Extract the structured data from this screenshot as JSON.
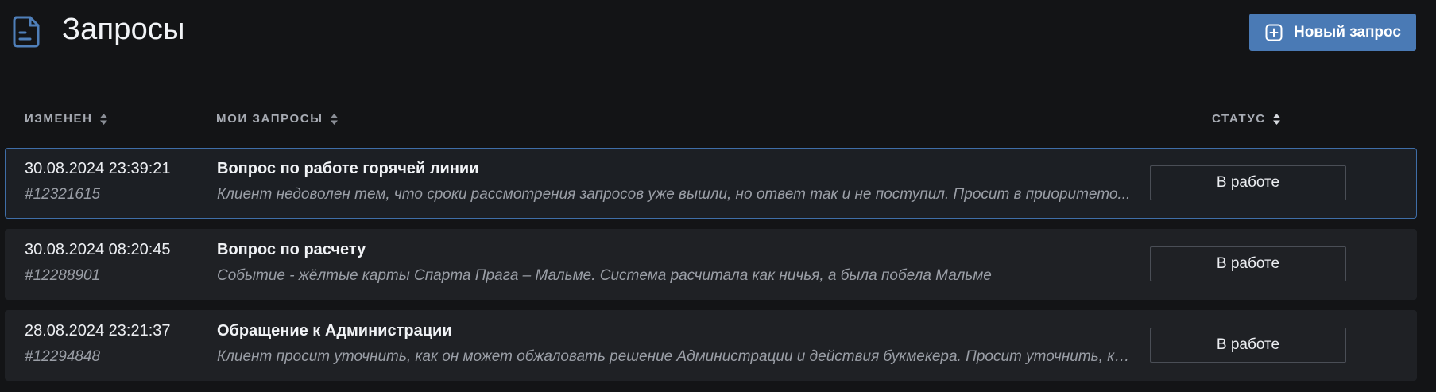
{
  "header": {
    "title": "Запросы",
    "icon": "document-icon",
    "new_request_label": "Новый запрос",
    "new_request_icon": "plus-square-icon"
  },
  "colors": {
    "background": "#131416",
    "row_background": "#1f2125",
    "accent": "#4a7ab5",
    "active_border": "#3f6ea8"
  },
  "table": {
    "columns": [
      {
        "key": "modified",
        "label": "ИЗМЕНЕН",
        "sortable": true
      },
      {
        "key": "requests",
        "label": "МОИ ЗАПРОСЫ",
        "sortable": true
      },
      {
        "key": "status",
        "label": "СТАТУС",
        "sortable": true
      }
    ],
    "rows": [
      {
        "date": "30.08.2024 23:39:21",
        "id": "#12321615",
        "title": "Вопрос по работе горячей линии",
        "description": "Клиент недоволен тем, что сроки рассмотрения запросов уже вышли, но ответ так и не поступил. Просит в приоритето...",
        "status": "В работе",
        "active": true
      },
      {
        "date": "30.08.2024 08:20:45",
        "id": "#12288901",
        "title": "Вопрос по расчету",
        "description": "Событие - жёлтые карты Спарта Прага – Мальме. Система расчитала как ничья, а была побела Мальме",
        "status": "В работе",
        "active": false
      },
      {
        "date": "28.08.2024 23:21:37",
        "id": "#12294848",
        "title": "Обращение к Администрации",
        "description": "Клиент просит уточнить, как он может обжаловать решение Администрации и действия букмекера. Просит уточнить, кт...",
        "status": "В работе",
        "active": false
      }
    ]
  }
}
